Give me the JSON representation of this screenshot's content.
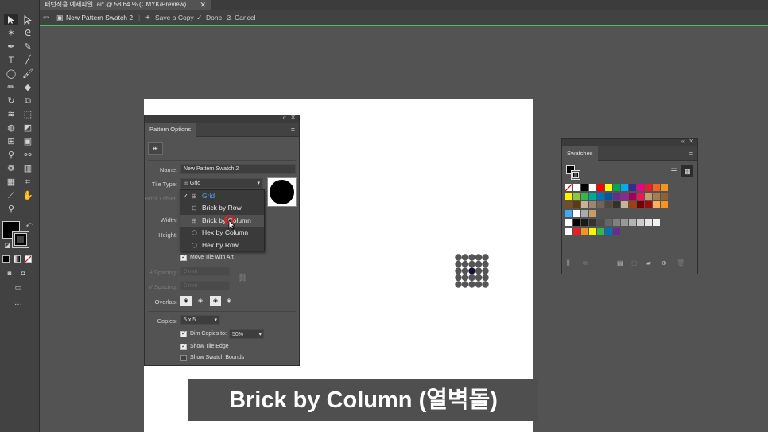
{
  "document_tab": {
    "title": "패턴적용 예제파일 .ai* @ 58.64 % (CMYK/Preview)",
    "close": "✕"
  },
  "control_bar": {
    "pattern_name": "New Pattern Swatch 2",
    "save_copy": "Save a Copy",
    "done": "Done",
    "cancel": "Cancel",
    "accent_color": "#3fc460"
  },
  "pattern_options": {
    "tab": "Pattern Options",
    "name_label": "Name:",
    "name_value": "New Pattern Swatch 2",
    "tile_type_label": "Tile Type:",
    "tile_type_value": "Grid",
    "brick_offset_label": "Brick Offset:",
    "width_label": "Width:",
    "height_label": "Height:",
    "move_tile_label": "Move Tile with Art",
    "h_spacing_label": "H Spacing:",
    "h_spacing_value": "0 mm",
    "v_spacing_label": "V Spacing:",
    "v_spacing_value": "0 mm",
    "overlap_label": "Overlap:",
    "copies_label": "Copies:",
    "copies_value": "5 x 5",
    "dim_copies_label": "Dim Copies to:",
    "dim_copies_value": "50%",
    "show_tile_edge_label": "Show Tile Edge",
    "show_swatch_bounds_label": "Show Swatch Bounds",
    "tile_types": [
      {
        "label": "Grid",
        "icon": "grid-icon",
        "selected": true
      },
      {
        "label": "Brick by Row",
        "icon": "brick-row-icon",
        "selected": false
      },
      {
        "label": "Brick by Column",
        "icon": "brick-column-icon",
        "selected": false
      },
      {
        "label": "Hex by Column",
        "icon": "hex-column-icon",
        "selected": false
      },
      {
        "label": "Hex by Row",
        "icon": "hex-row-icon",
        "selected": false
      }
    ]
  },
  "swatches_panel": {
    "tab": "Swatches"
  },
  "caption": {
    "text": "Brick by Column (열벽돌)"
  }
}
